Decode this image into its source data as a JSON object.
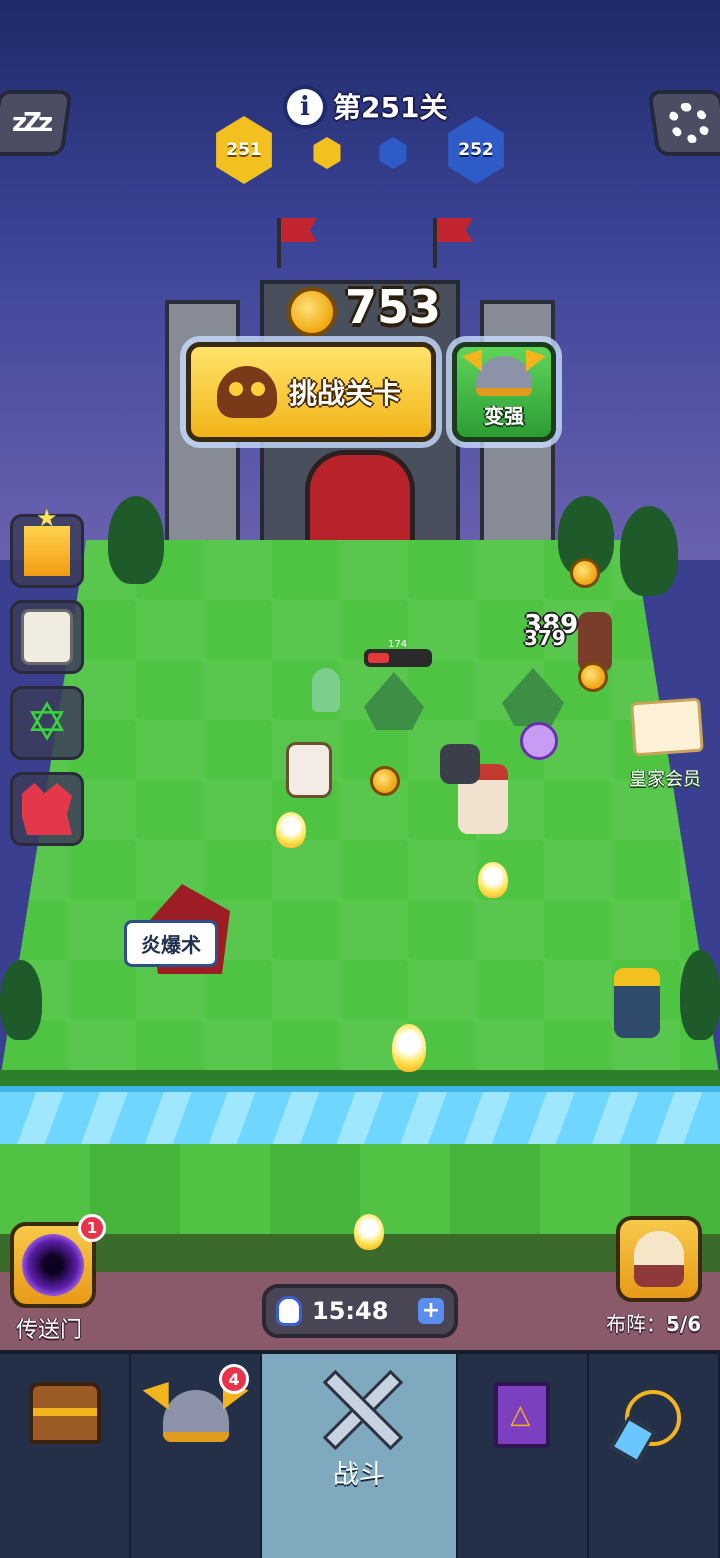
{
  "header": {
    "level_title": "第251关",
    "current_level": "251",
    "next_level": "252"
  },
  "gold": {
    "amount": "753"
  },
  "actions": {
    "challenge_label": "挑战关卡",
    "power_up_label": "变强"
  },
  "battlefield": {
    "enemy_hp_label": "174",
    "enemy_hp_fraction": 0.35,
    "damage_numbers": [
      "389",
      "379"
    ],
    "skill_tag": "炎爆术",
    "royal_member_label": "皇家会员"
  },
  "portal": {
    "label": "传送门",
    "badge": "1"
  },
  "timer": {
    "value": "15:48",
    "plus": "+"
  },
  "formation": {
    "label": "布阵：",
    "count": "5/6"
  },
  "tabs": [
    {
      "id": "treasure",
      "icon": "chest-icon",
      "label": ""
    },
    {
      "id": "hero",
      "icon": "helmet-icon",
      "label": "",
      "badge": "4"
    },
    {
      "id": "battle",
      "icon": "crossed-swords-icon",
      "label": "战斗",
      "active": true
    },
    {
      "id": "spellbook",
      "icon": "book-icon",
      "label": ""
    },
    {
      "id": "equipment",
      "icon": "amulet-icon",
      "label": ""
    }
  ],
  "colors": {
    "gold_button": "#f2b418",
    "green_button": "#2d9c33",
    "badge_red": "#e8334a",
    "active_tab": "#7fa9bf",
    "tab_bar": "#233047"
  }
}
